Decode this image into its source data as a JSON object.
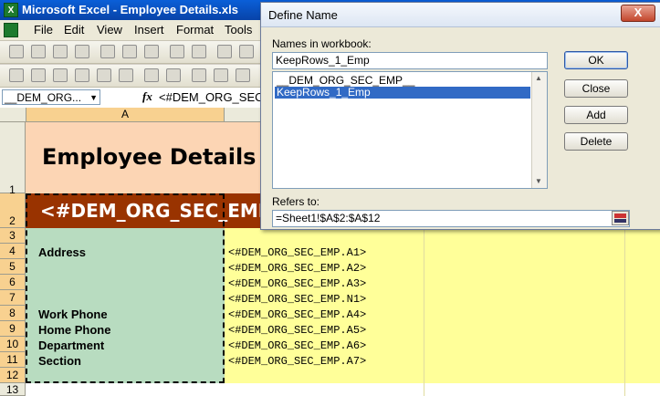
{
  "window": {
    "title": "Microsoft Excel - Employee Details.xls",
    "app_icon": "excel-icon"
  },
  "menu": {
    "items": [
      "File",
      "Edit",
      "View",
      "Insert",
      "Format",
      "Tools"
    ]
  },
  "formula_bar": {
    "name_box": "__DEM_ORG...",
    "fx": "fx",
    "formula": "<#DEM_ORG_SEC"
  },
  "sheet": {
    "column_a_header": "A",
    "rows": [
      "1",
      "2",
      "3",
      "4",
      "5",
      "6",
      "7",
      "8",
      "9",
      "10",
      "11",
      "12",
      "13"
    ],
    "title": "Employee Details",
    "header_row_value": "<#DEM_ORG_SEC_EMP.V",
    "labels": {
      "address": "Address",
      "work_phone": "Work Phone",
      "home_phone": "Home Phone",
      "department": "Department",
      "section": "Section"
    },
    "values": [
      "<#DEM_ORG_SEC_EMP.A1>",
      "<#DEM_ORG_SEC_EMP.A2>",
      "<#DEM_ORG_SEC_EMP.A3>",
      "<#DEM_ORG_SEC_EMP.N1>",
      "<#DEM_ORG_SEC_EMP.A4>",
      "<#DEM_ORG_SEC_EMP.A5>",
      "<#DEM_ORG_SEC_EMP.A6>",
      "<#DEM_ORG_SEC_EMP.A7>"
    ]
  },
  "dialog": {
    "title": "Define Name",
    "close": "X",
    "names_label": "Names in workbook:",
    "name_value": "KeepRows_1_Emp",
    "list": [
      "__DEM_ORG_SEC_EMP__",
      "KeepRows_1_Emp"
    ],
    "refers_label": "Refers to:",
    "refers_value": "=Sheet1!$A$2:$A$12",
    "buttons": {
      "ok": "OK",
      "close": "Close",
      "add": "Add",
      "delete": "Delete"
    }
  },
  "colors": {
    "title_fill": "#fcd5b4",
    "header_fill": "#993300",
    "label_fill": "#b8dcc0",
    "value_fill": "#ffff99",
    "selection": "#316ac5"
  }
}
